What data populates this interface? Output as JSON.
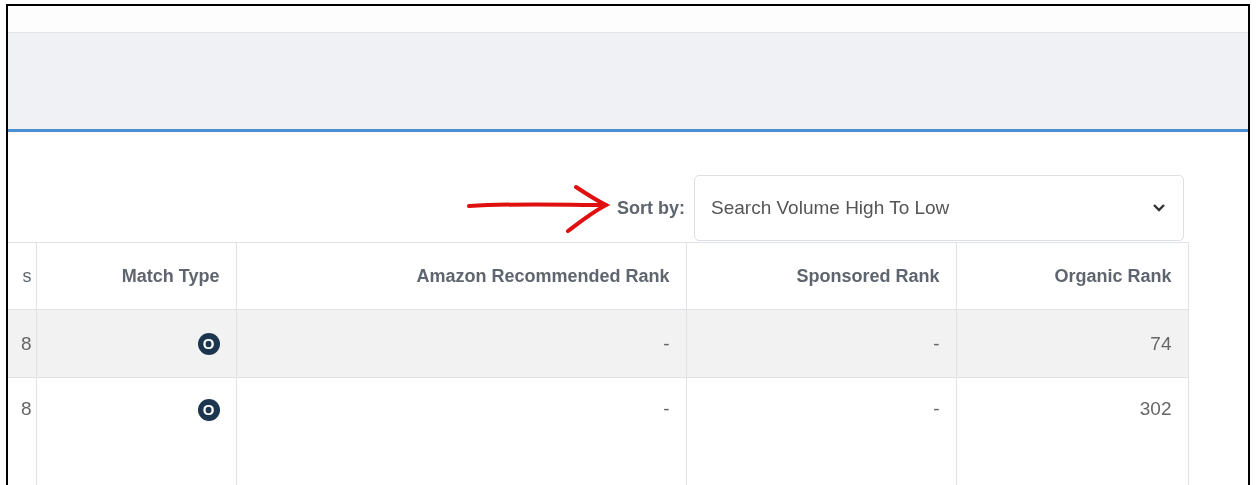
{
  "sort": {
    "label": "Sort by:",
    "value": "Search Volume High To Low"
  },
  "table": {
    "columns": [
      "s",
      "Match Type",
      "Amazon Recommended Rank",
      "Sponsored Rank",
      "Organic Rank"
    ],
    "rows": [
      {
        "cells": [
          "8",
          "O",
          "-",
          "-",
          "74"
        ]
      },
      {
        "cells": [
          "8",
          "O",
          "-",
          "-",
          "302"
        ]
      }
    ]
  }
}
